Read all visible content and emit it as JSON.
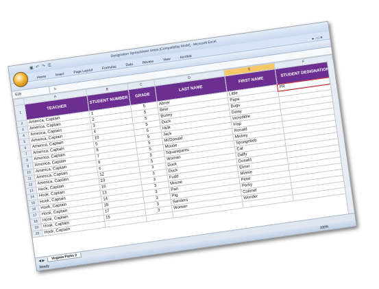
{
  "window": {
    "title": "Designation Spreadsheet Steps [Compatibility Mode] - Microsoft Excel",
    "qat": "▣ ↶ ↷ ☰"
  },
  "ribbon": {
    "tabs": [
      "Home",
      "Insert",
      "Page Layout",
      "Formulas",
      "Data",
      "Review",
      "View",
      "Acrobat"
    ]
  },
  "formula_bar": {
    "name_box": "E28",
    "fx": "fx"
  },
  "columns": [
    "A",
    "B",
    "C",
    "D",
    "E",
    "F"
  ],
  "headers": {
    "teacher": "TEACHER",
    "student_number": "STUDENT NUMBER",
    "grade": "GRADE",
    "last_name": "LAST NAME",
    "first_name": "FIRST NAME",
    "designation": "STUDENT DESIGNATION"
  },
  "rows": [
    {
      "n": "1",
      "teacher": "",
      "num": "",
      "grade": "",
      "last": "",
      "first": "",
      "des": ""
    },
    {
      "n": "2",
      "teacher": "America, Captain",
      "num": "1",
      "grade": "5",
      "last": "Abner",
      "first": "Little",
      "des": "PR"
    },
    {
      "n": "3",
      "teacher": "America, Captain",
      "num": "2",
      "grade": "5",
      "last": "Bear",
      "first": "Papa",
      "des": ""
    },
    {
      "n": "4",
      "teacher": "America, Captain",
      "num": "3",
      "grade": "5",
      "last": "Bunny",
      "first": "Bugs",
      "des": ""
    },
    {
      "n": "5",
      "teacher": "America, Captain",
      "num": "4",
      "grade": "5",
      "last": "Duck",
      "first": "Daisy",
      "des": ""
    },
    {
      "n": "6",
      "teacher": "America, Captain",
      "num": "10",
      "grade": "5",
      "last": "Hulk",
      "first": "Incredible",
      "des": ""
    },
    {
      "n": "7",
      "teacher": "America, Captain",
      "num": "5",
      "grade": "5",
      "last": "Jack",
      "first": "Flap",
      "des": ""
    },
    {
      "n": "8",
      "teacher": "America, Captain",
      "num": "8",
      "grade": "5",
      "last": "McDonald",
      "first": "Ronald",
      "des": ""
    },
    {
      "n": "9",
      "teacher": "America, Captain",
      "num": "7",
      "grade": "5",
      "last": "Mouse",
      "first": "Mickey",
      "des": ""
    },
    {
      "n": "10",
      "teacher": "America, Captain",
      "num": "9",
      "grade": "5",
      "last": "Squarepants",
      "first": "Spongebob",
      "des": ""
    },
    {
      "n": "11",
      "teacher": "America, Captain",
      "num": "6",
      "grade": "5",
      "last": "Woman",
      "first": "Cat",
      "des": ""
    },
    {
      "n": "12",
      "teacher": "America, Captain",
      "num": "12",
      "grade": "3",
      "last": "Duck",
      "first": "Daffy",
      "des": ""
    },
    {
      "n": "13",
      "teacher": "Hook, Captain",
      "num": "23",
      "grade": "3",
      "last": "Duck",
      "first": "Donald",
      "des": ""
    },
    {
      "n": "14",
      "teacher": "Hook, Captain",
      "num": "16",
      "grade": "3",
      "last": "Fudd",
      "first": "Elmer",
      "des": ""
    },
    {
      "n": "15",
      "teacher": "Hook, Captain",
      "num": "13",
      "grade": "3",
      "last": "Mouse",
      "first": "Minnie",
      "des": ""
    },
    {
      "n": "16",
      "teacher": "Hook, Captain",
      "num": "14",
      "grade": "3",
      "last": "Pan",
      "first": "Peter",
      "des": ""
    },
    {
      "n": "17",
      "teacher": "Hook, Captain",
      "num": "18",
      "grade": "3",
      "last": "Pig",
      "first": "Porky",
      "des": ""
    },
    {
      "n": "18",
      "teacher": "Hook, Captain",
      "num": "17",
      "grade": "3",
      "last": "Sanders",
      "first": "Colonel",
      "des": ""
    },
    {
      "n": "19",
      "teacher": "Hook, Captain",
      "num": "15",
      "grade": "3",
      "last": "Woman",
      "first": "Wonder",
      "des": ""
    },
    {
      "n": "20",
      "teacher": "Hook, Captain",
      "num": "",
      "grade": "",
      "last": "",
      "first": "",
      "des": ""
    }
  ],
  "sheet_tab": "Virginia Parks 2",
  "sheet_nav": "◀ ▶",
  "status": {
    "ready": "Ready",
    "zoom": "100%"
  },
  "window_buttons": "– □ ✕",
  "help": "● - □ ✕"
}
